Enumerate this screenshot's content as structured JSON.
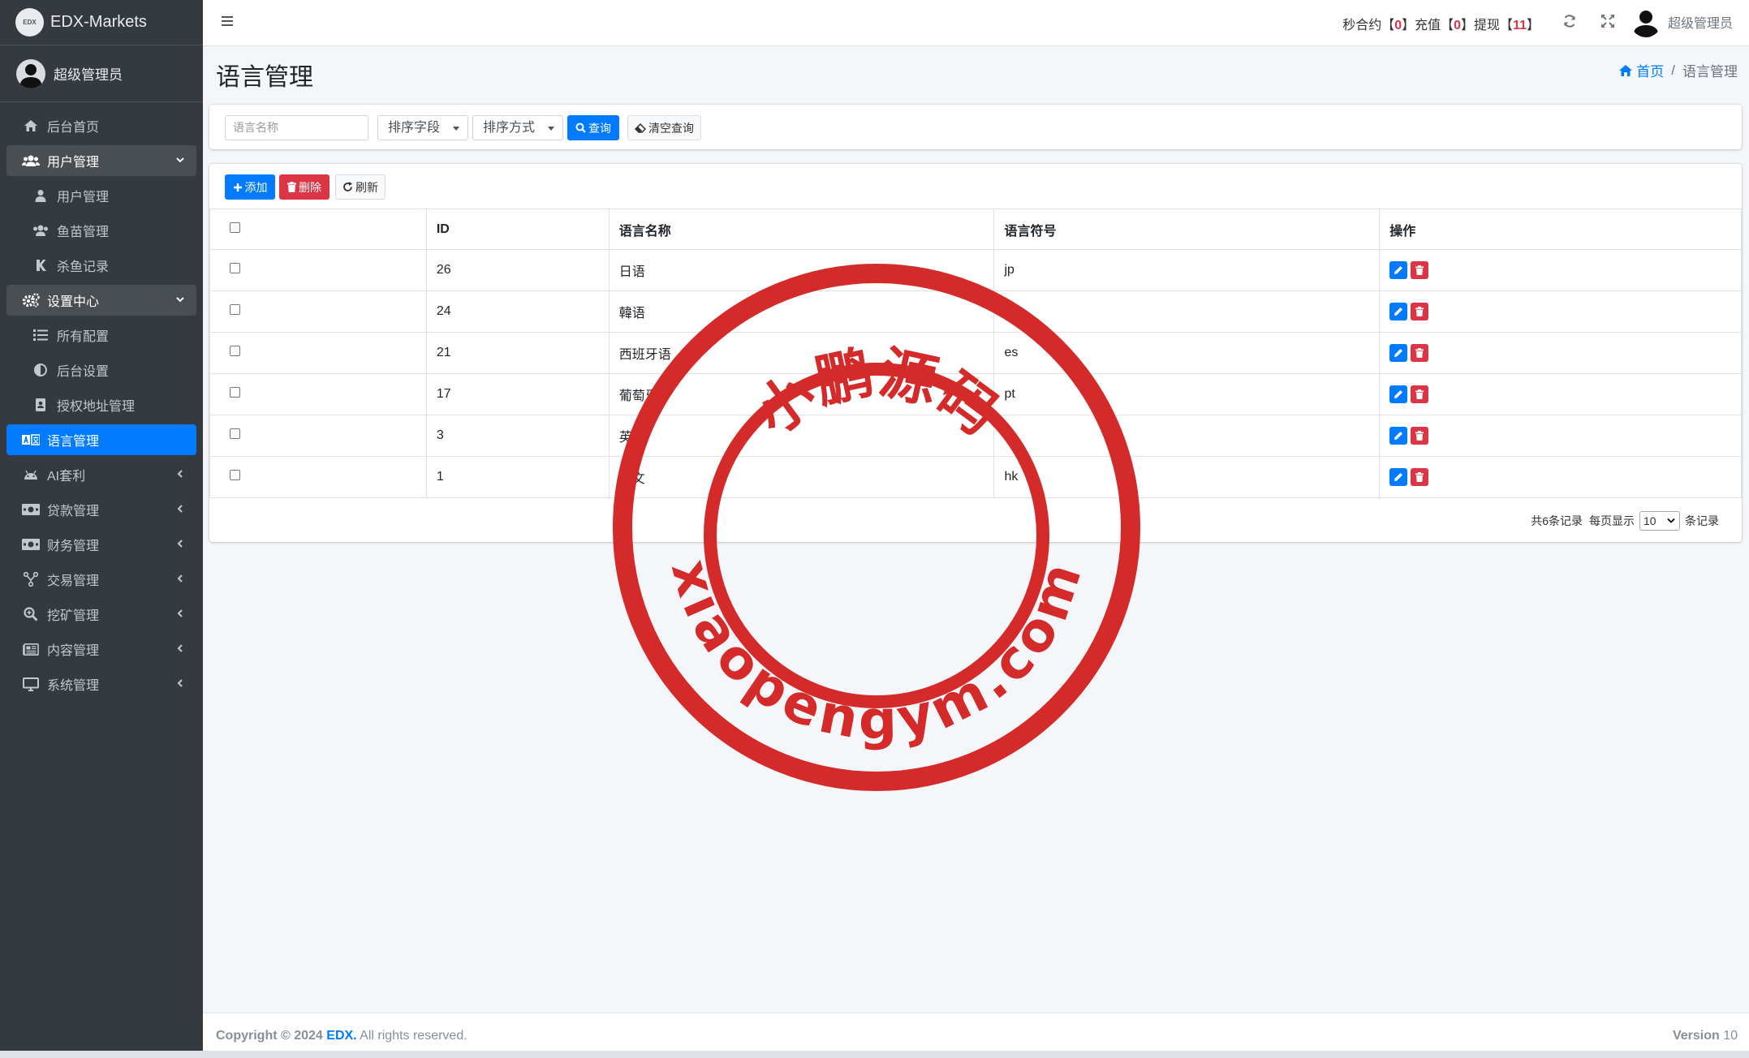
{
  "brand": {
    "logo_text": "EDX",
    "name": "EDX-Markets"
  },
  "sidebar": {
    "user_name": "超级管理员",
    "items": [
      {
        "label": "后台首页",
        "icon": "home-icon"
      },
      {
        "label": "用户管理",
        "icon": "users-icon"
      },
      {
        "label": "用户管理",
        "icon": "user-icon"
      },
      {
        "label": "鱼苗管理",
        "icon": "users-icon"
      },
      {
        "label": "杀鱼记录",
        "icon": "k-icon"
      },
      {
        "label": "设置中心",
        "icon": "cogs-icon"
      },
      {
        "label": "所有配置",
        "icon": "list-icon"
      },
      {
        "label": "后台设置",
        "icon": "adjust-icon"
      },
      {
        "label": "授权地址管理",
        "icon": "address-book-icon"
      },
      {
        "label": "语言管理",
        "icon": "language-icon"
      },
      {
        "label": "AI套利",
        "icon": "android-icon"
      },
      {
        "label": "贷款管理",
        "icon": "money-icon"
      },
      {
        "label": "财务管理",
        "icon": "money-icon"
      },
      {
        "label": "交易管理",
        "icon": "share-icon"
      },
      {
        "label": "挖矿管理",
        "icon": "search-plus-icon"
      },
      {
        "label": "内容管理",
        "icon": "newspaper-icon"
      },
      {
        "label": "系统管理",
        "icon": "desktop-icon"
      }
    ]
  },
  "header": {
    "stats": {
      "l1": "秒合约【",
      "v1": "0",
      "l2": "】充值【",
      "v2": "0",
      "l3": "】提现【",
      "v3": "11",
      "l4": "】"
    },
    "user_name": "超级管理员"
  },
  "page": {
    "title": "语言管理",
    "breadcrumb": {
      "home": "首页",
      "current": "语言管理"
    }
  },
  "search": {
    "name_placeholder": "语言名称",
    "sort_field": "排序字段",
    "sort_order": "排序方式",
    "query_label": "查询",
    "clear_label": "清空查询"
  },
  "toolbar": {
    "add_label": "添加",
    "delete_label": "删除",
    "refresh_label": "刷新"
  },
  "table": {
    "columns": [
      "ID",
      "语言名称",
      "语言符号",
      "操作"
    ],
    "rows": [
      {
        "id": "26",
        "name": "日语",
        "symbol": "jp"
      },
      {
        "id": "24",
        "name": "韓语",
        "symbol": ""
      },
      {
        "id": "21",
        "name": "西班牙语",
        "symbol": "es"
      },
      {
        "id": "17",
        "name": "葡萄牙",
        "symbol": "pt"
      },
      {
        "id": "3",
        "name": "英文",
        "symbol": ""
      },
      {
        "id": "1",
        "name": "中文",
        "symbol": "hk"
      }
    ]
  },
  "pagination": {
    "total": "共6条记录",
    "per_page_label": "每页显示",
    "per_page_value": "10",
    "suffix": "条记录"
  },
  "footer": {
    "copyright": "Copyright © 2024 ",
    "brand": "EDX.",
    "rights": " All rights reserved.",
    "version_label": "Version",
    "version": " 10"
  },
  "watermark": {
    "top_text": "小鹏源码",
    "bottom_text": "xiaopengym.com"
  },
  "colors": {
    "primary": "#007bff",
    "danger": "#dc3545",
    "sidebar": "#343a40",
    "stamp": "#d42a2a"
  }
}
